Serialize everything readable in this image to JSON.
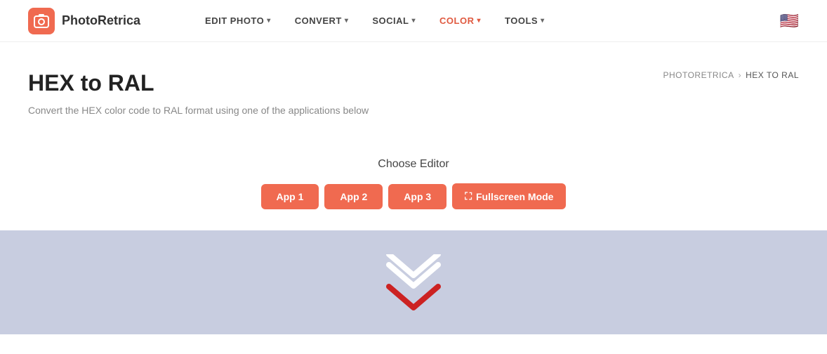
{
  "logo": {
    "icon": "📷",
    "text": "PhotoRetrica"
  },
  "nav": {
    "items": [
      {
        "id": "edit-photo",
        "label": "EDIT PHOTO",
        "active": false
      },
      {
        "id": "convert",
        "label": "CONVERT",
        "active": false
      },
      {
        "id": "social",
        "label": "SOCIAL",
        "active": false
      },
      {
        "id": "color",
        "label": "COLOR",
        "active": true
      },
      {
        "id": "tools",
        "label": "TOOLS",
        "active": false
      }
    ]
  },
  "breadcrumb": {
    "home": "PHOTORETRICA",
    "separator": "›",
    "current": "HEX TO RAL"
  },
  "page": {
    "title": "HEX to RAL",
    "subtitle": "Convert the HEX color code to RAL format using one of the applications below"
  },
  "editor": {
    "label": "Choose Editor",
    "buttons": [
      {
        "id": "app1",
        "label": "App 1"
      },
      {
        "id": "app2",
        "label": "App 2"
      },
      {
        "id": "app3",
        "label": "App 3"
      }
    ],
    "fullscreen_label": "Fullscreen Mode"
  },
  "colors": {
    "brand": "#f06a50",
    "preview_bg": "#c8cde0",
    "chevron_white": "#ffffff",
    "chevron_red": "#cc2222"
  }
}
